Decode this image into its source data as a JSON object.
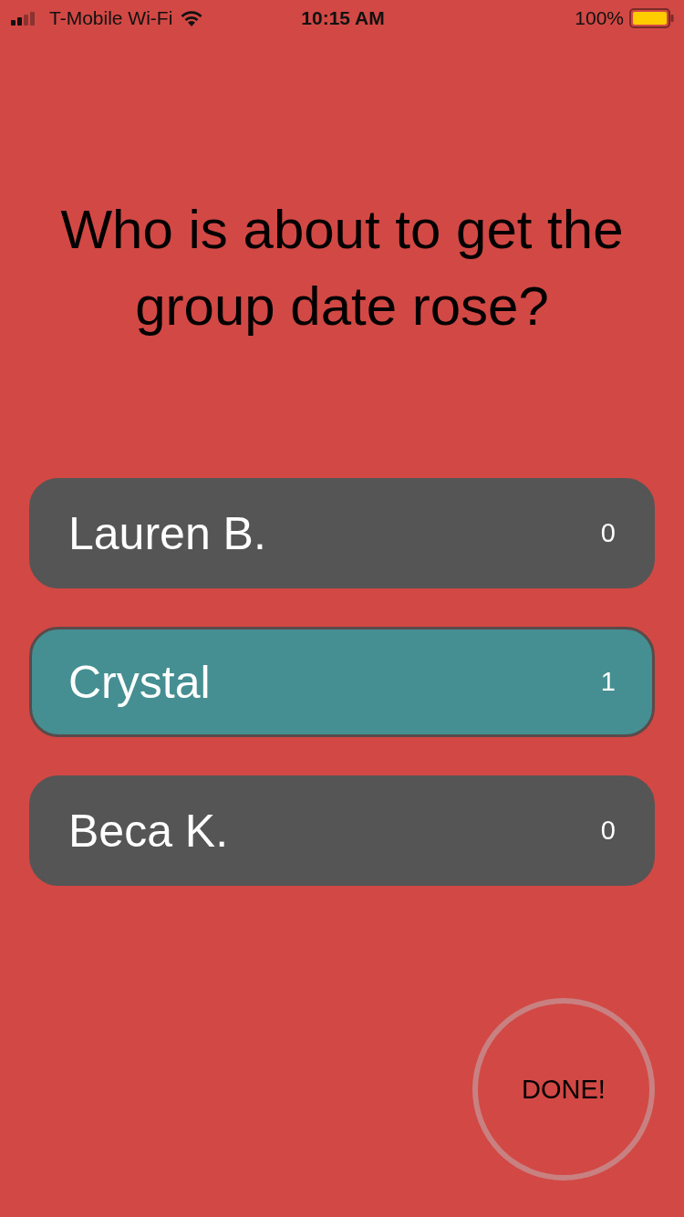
{
  "status_bar": {
    "carrier": "T-Mobile Wi-Fi",
    "time": "10:15 AM",
    "battery": "100%"
  },
  "question": "Who is about to get the group date rose?",
  "options": [
    {
      "name": "Lauren B.",
      "count": "0",
      "selected": false
    },
    {
      "name": "Crystal",
      "count": "1",
      "selected": true
    },
    {
      "name": "Beca K.",
      "count": "0",
      "selected": false
    }
  ],
  "done_button": {
    "label": "DONE!"
  }
}
